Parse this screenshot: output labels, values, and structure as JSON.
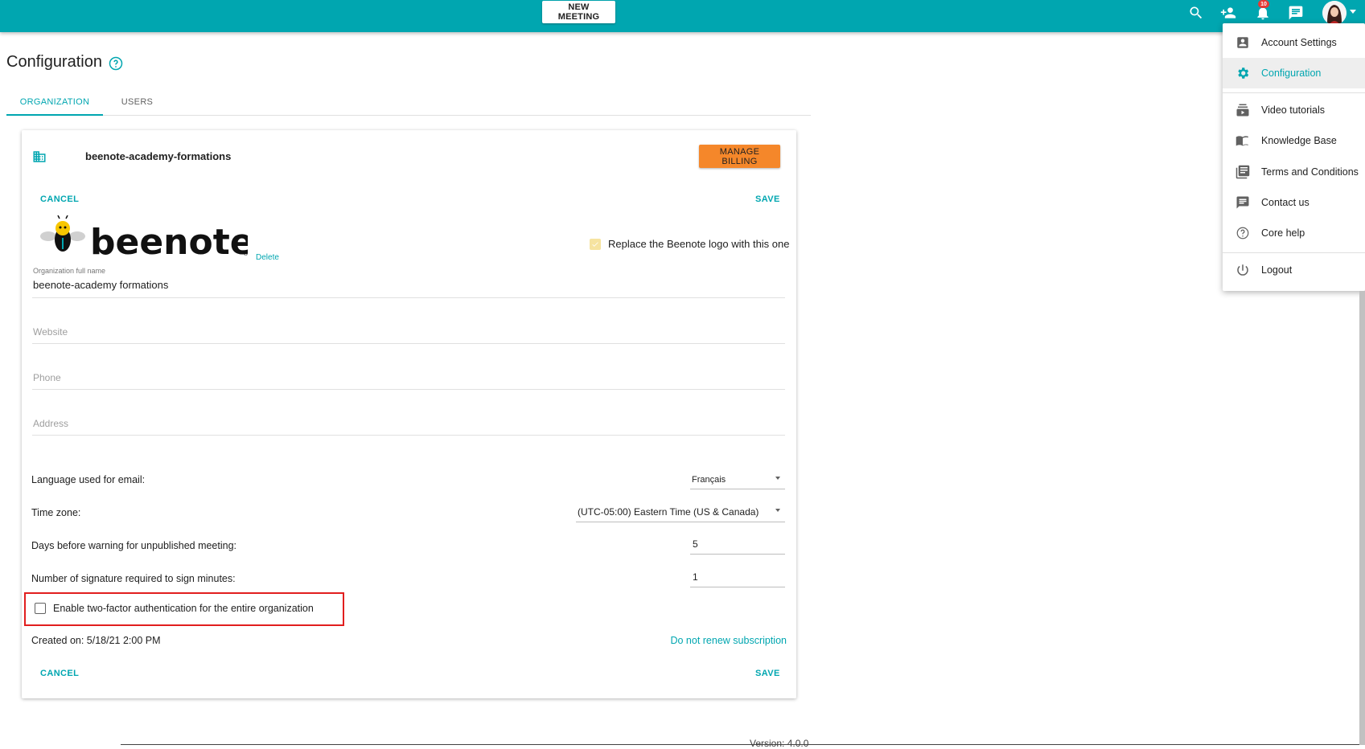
{
  "topbar": {
    "new_meeting_label": "NEW MEETING",
    "notification_count": "10",
    "icons": [
      "search-icon",
      "add-person-icon",
      "bell-icon",
      "chat-icon"
    ],
    "color": "#00a6b0"
  },
  "page": {
    "title": "Configuration",
    "tabs": [
      {
        "label": "ORGANIZATION",
        "active": true
      },
      {
        "label": "USERS",
        "active": false
      }
    ],
    "version": "Version: 4.0.0"
  },
  "card": {
    "org_name": "beenote-academy-formations",
    "manage_billing_label": "MANAGE BILLING",
    "cancel_label": "CANCEL",
    "save_label": "SAVE",
    "logo_text": "beenote",
    "logo_delete_label": "Delete",
    "replace_logo_label": "Replace the Beenote logo with this one",
    "replace_logo_checked": true,
    "fields": {
      "org_full_name_label": "Organization full name",
      "org_full_name_value": "beenote-academy formations",
      "website_placeholder": "Website",
      "phone_placeholder": "Phone",
      "address_placeholder": "Address"
    },
    "settings": {
      "language_label": "Language used for email:",
      "language_value": "Français",
      "timezone_label": "Time zone:",
      "timezone_value": "(UTC-05:00) Eastern Time (US & Canada)",
      "days_warning_label": "Days before warning for unpublished meeting:",
      "days_warning_value": "5",
      "signatures_label": "Number of signature required to sign minutes:",
      "signatures_value": "1"
    },
    "two_factor_label": "Enable two-factor authentication for the entire organization",
    "two_factor_checked": false,
    "created_on": "Created on: 5/18/21 2:00 PM",
    "no_renew_label": "Do not renew subscription"
  },
  "menu": {
    "items": [
      {
        "label": "Account Settings",
        "icon": "account-box-icon",
        "active": false
      },
      {
        "label": "Configuration",
        "icon": "gear-icon",
        "active": true
      },
      {
        "label": "Video tutorials",
        "icon": "video-library-icon",
        "active": false
      },
      {
        "label": "Knowledge Base",
        "icon": "book-icon",
        "active": false
      },
      {
        "label": "Terms and Conditions",
        "icon": "document-list-icon",
        "active": false
      },
      {
        "label": "Contact us",
        "icon": "message-icon",
        "active": false
      },
      {
        "label": "Core help",
        "icon": "help-circle-icon",
        "active": false
      },
      {
        "label": "Logout",
        "icon": "power-icon",
        "active": false
      }
    ]
  }
}
